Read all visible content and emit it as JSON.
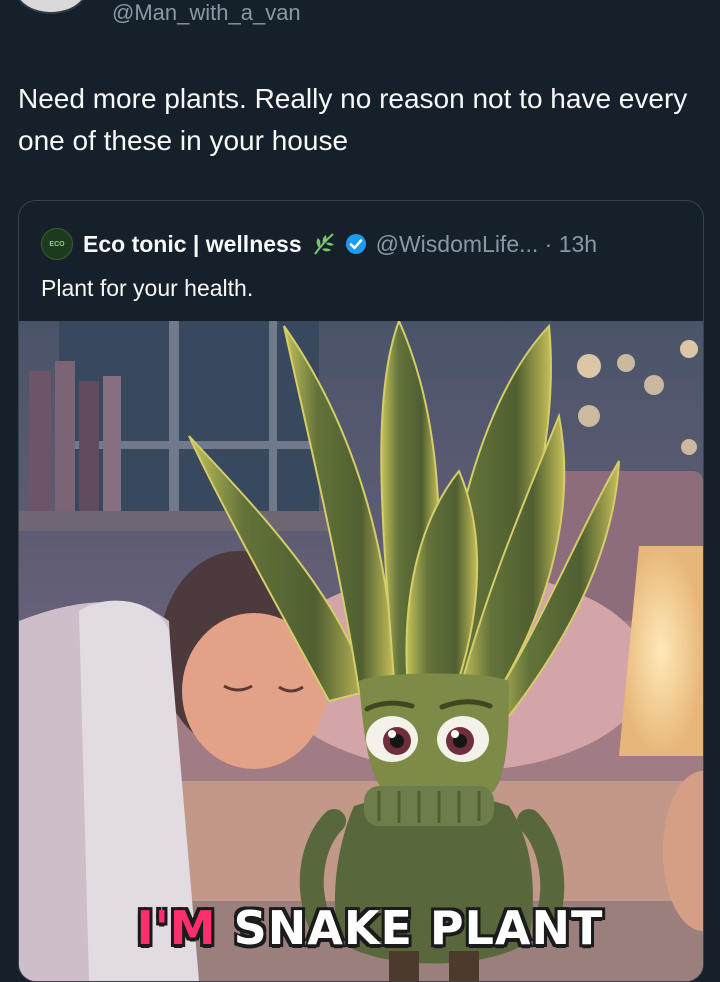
{
  "author": {
    "handle": "@Man_with_a_van",
    "avatar": "van-avatar-icon"
  },
  "post": {
    "text": "Need more plants.  Really no reason not to have every one of these in your house"
  },
  "quote": {
    "avatar_label": "ECO",
    "name": "Eco tonic | wellness",
    "handle_time": "@WisdomLife... · 13h",
    "text": "Plant for your health.",
    "icons": [
      "leaf-icon",
      "verified-icon"
    ],
    "verified_color": "#1d9bf0"
  },
  "media": {
    "caption_pre": "I'M",
    "caption_post": " SNAKE PLANT",
    "caption_pre_color": "#ff2f6d"
  },
  "colors": {
    "background": "#15202b",
    "border": "#38444d",
    "muted_text": "#8b98a5",
    "text": "#f7f9f9"
  }
}
